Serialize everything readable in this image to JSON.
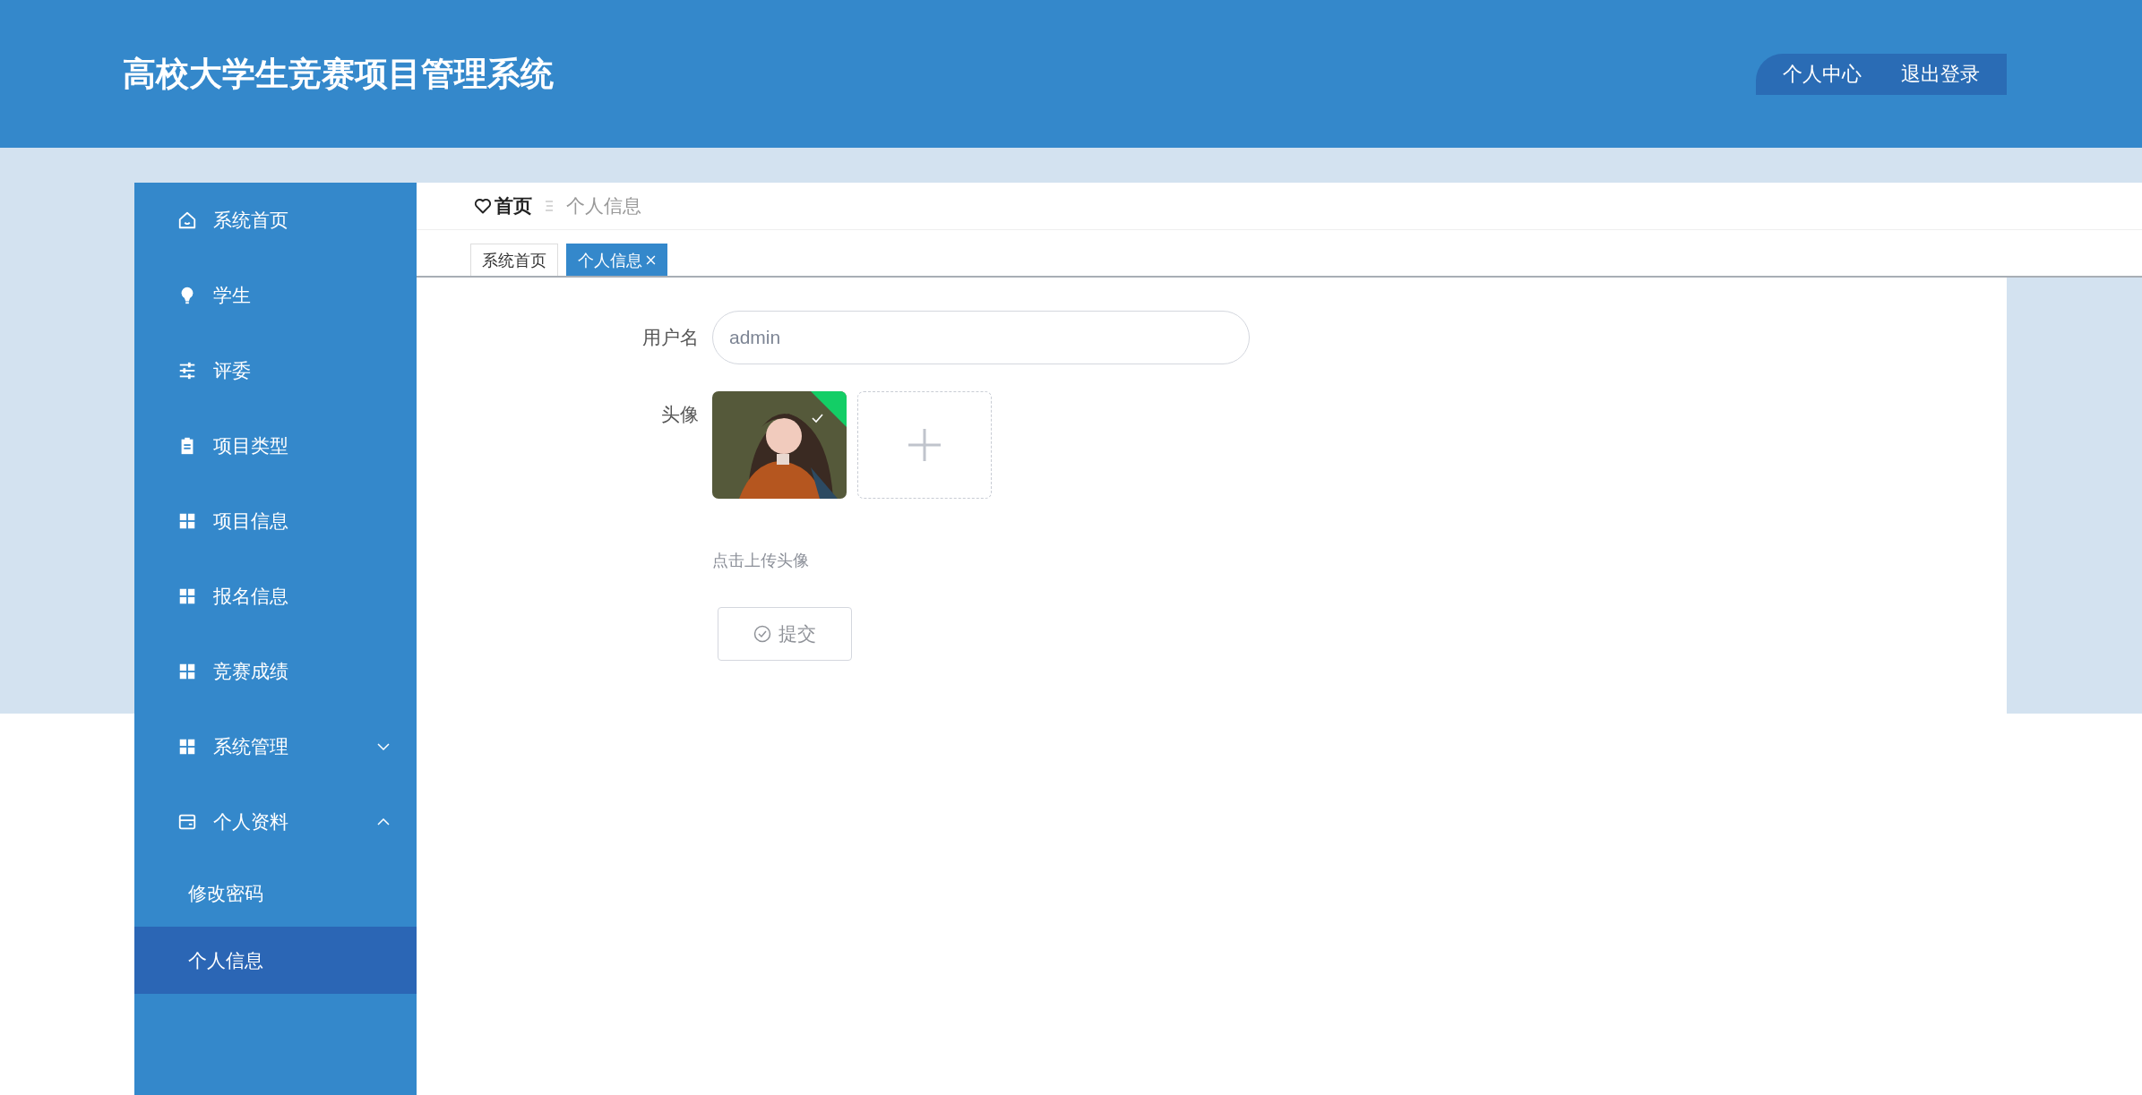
{
  "header": {
    "title": "高校大学生竞赛项目管理系统",
    "links": [
      "个人中心",
      "退出登录"
    ]
  },
  "sidebar": {
    "items": [
      {
        "label": "系统首页",
        "kind": "link",
        "selected": false
      },
      {
        "label": "学生",
        "kind": "link",
        "selected": false
      },
      {
        "label": "评委",
        "kind": "link",
        "selected": false
      },
      {
        "label": "项目类型",
        "kind": "link",
        "selected": false
      },
      {
        "label": "项目信息",
        "kind": "link",
        "selected": false
      },
      {
        "label": "报名信息",
        "kind": "link",
        "selected": false
      },
      {
        "label": "竞赛成绩",
        "kind": "link",
        "selected": false
      },
      {
        "label": "系统管理",
        "kind": "group",
        "expanded": false,
        "selected": false
      },
      {
        "label": "个人资料",
        "kind": "group",
        "expanded": true,
        "selected": false,
        "children": [
          {
            "label": "修改密码",
            "selected": false
          },
          {
            "label": "个人信息",
            "selected": true
          }
        ]
      }
    ]
  },
  "breadcrumb": [
    "首页",
    "个人信息"
  ],
  "tabs": [
    {
      "label": "系统首页",
      "selected": false,
      "closable": false
    },
    {
      "label": "个人信息",
      "selected": true,
      "closable": true
    }
  ],
  "form": {
    "fields": [
      {
        "label": "用户名",
        "kind": "text",
        "value": "admin"
      },
      {
        "label": "头像",
        "uploaded": true,
        "hint": "点击上传头像"
      }
    ],
    "submit": "提交"
  }
}
